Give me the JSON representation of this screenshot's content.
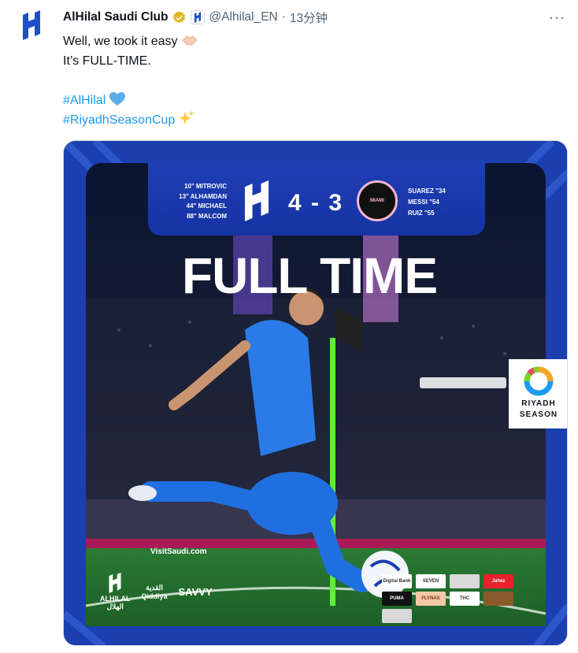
{
  "tweet": {
    "author_name": "AlHilal Saudi Club",
    "handle": "@Alhilal_EN",
    "separator": "·",
    "time": "13分钟",
    "more_label": "···",
    "lines": {
      "line1": "Well, we took it easy",
      "line2": "It’s FULL-TIME.",
      "hashtag1": "#AlHilal",
      "hashtag2": "#RiyadhSeasonCup"
    },
    "emojis": [
      "handshake",
      "blue-heart",
      "sparkles"
    ]
  },
  "media": {
    "home_scorers": [
      "10\" MITROVIC",
      "13\" ALHAMDAN",
      "44\" MICHAEL",
      "88\" MALCOM"
    ],
    "away_scorers": [
      "SUAREZ \"34",
      "MESSI \"54",
      "RUIZ \"55"
    ],
    "score": "4 - 3",
    "headline": "FULL TIME",
    "away_badge_text": "MIAMI",
    "riyadh_season": [
      "RIYADH",
      "SEASON"
    ],
    "ad_board_text": "VisitSaudi.com",
    "footer_sponsors": {
      "hilal_arabic": "الهلال",
      "hilal_latin": "ALHILAL",
      "qiddiya_arabic": "القدية",
      "qiddiya_latin": "Qiddiya",
      "savvy": "SAVVY"
    },
    "sponsor_chips": [
      "Digital Bank",
      "SEVEN",
      "",
      "Jahez",
      "PUMA",
      "FLYNAS",
      "THC",
      "",
      ""
    ]
  },
  "colors": {
    "hashtag_blue": "#1d9bf0",
    "verified_gold": "#e2b719",
    "media_blue": "#1a3fb0"
  }
}
